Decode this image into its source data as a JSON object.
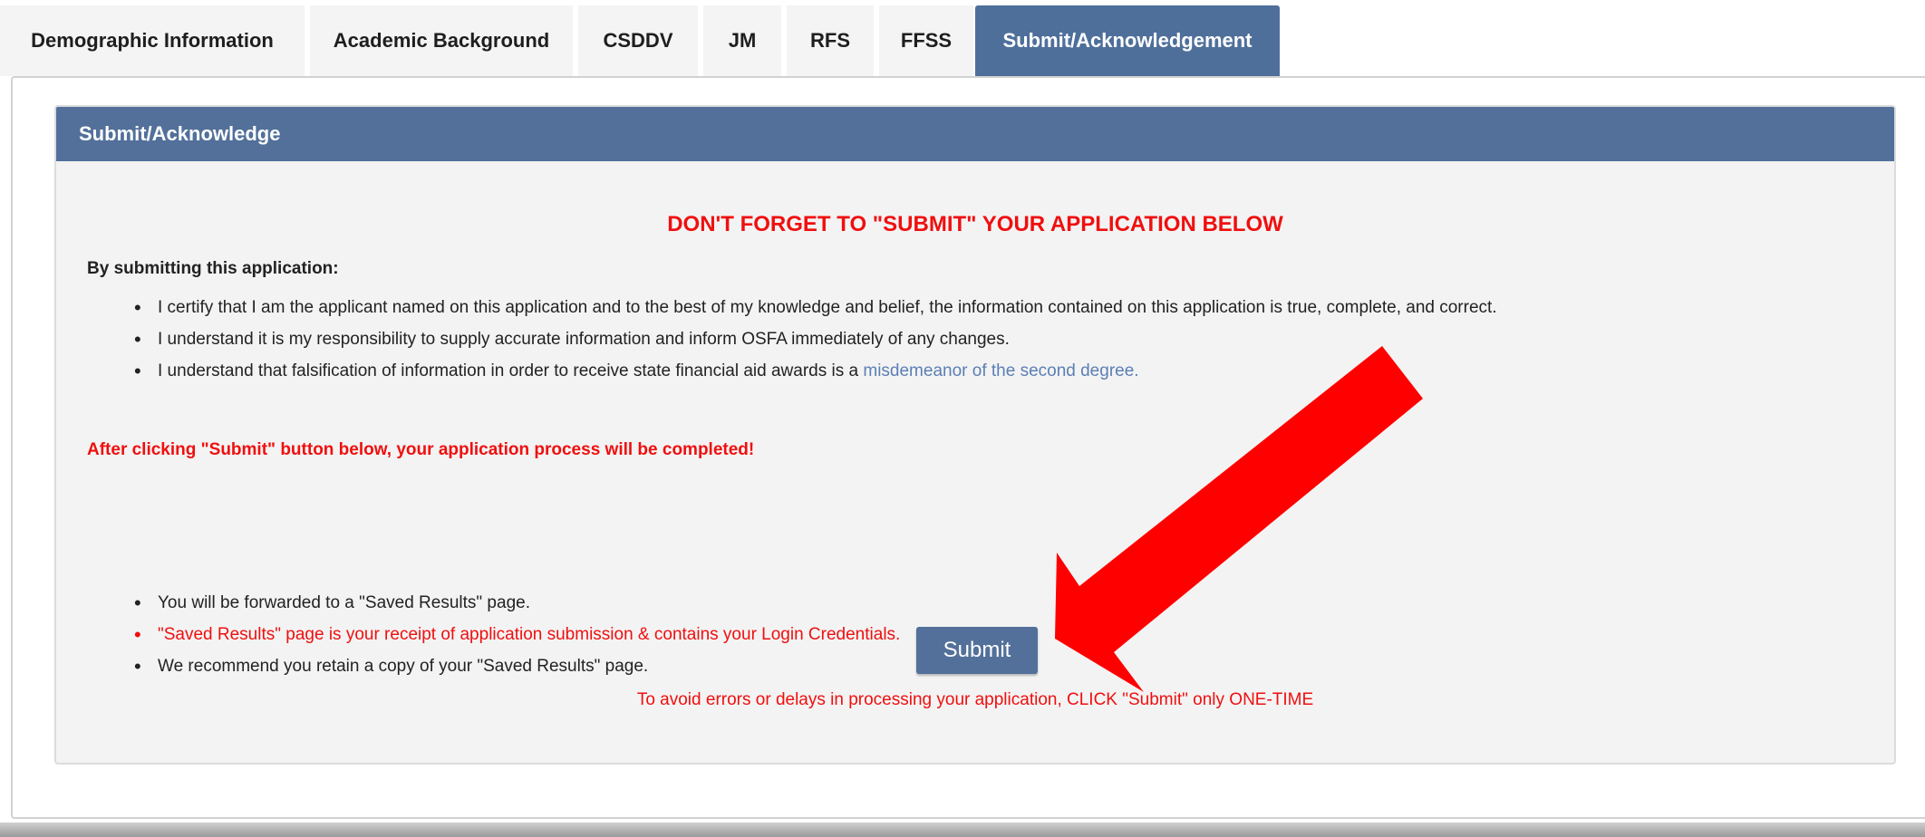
{
  "tabs": [
    {
      "label": "Demographic Information",
      "active": false
    },
    {
      "label": "Academic Background",
      "active": false
    },
    {
      "label": "CSDDV",
      "active": false
    },
    {
      "label": "JM",
      "active": false
    },
    {
      "label": "RFS",
      "active": false
    },
    {
      "label": "FFSS",
      "active": false
    },
    {
      "label": "Submit/Acknowledgement",
      "active": true
    }
  ],
  "panel": {
    "title": "Submit/Acknowledge",
    "headline": "DON'T FORGET TO \"SUBMIT\" YOUR APPLICATION BELOW",
    "by_submitting": "By submitting this application:",
    "certify_items": [
      "I certify that I am the applicant named on this application and to the best of my knowledge and belief, the information contained on this application is true, complete, and correct.",
      "I understand it is my responsibility to supply accurate information and inform OSFA immediately of any changes."
    ],
    "falsification_text": "I understand that falsification of information in order to receive state financial aid awards is a ",
    "falsification_link": "misdemeanor of the second degree.",
    "after_click": "After clicking \"Submit\" button below, your application process will be completed!",
    "result_items": [
      "You will be forwarded to a \"Saved Results\" page.",
      "\"Saved Results\" page is your receipt of application submission & contains your Login Credentials.",
      "We recommend you retain a copy of your \"Saved Results\" page."
    ],
    "submit_label": "Submit",
    "note": "To avoid errors or delays in processing your application, CLICK \"Submit\" only ONE-TIME"
  },
  "colors": {
    "accent": "#52709a",
    "warning": "#f00f0f",
    "link": "#5b7fb5",
    "arrow": "#ff0000"
  },
  "icons": {
    "arrow": "red-arrow-icon"
  }
}
